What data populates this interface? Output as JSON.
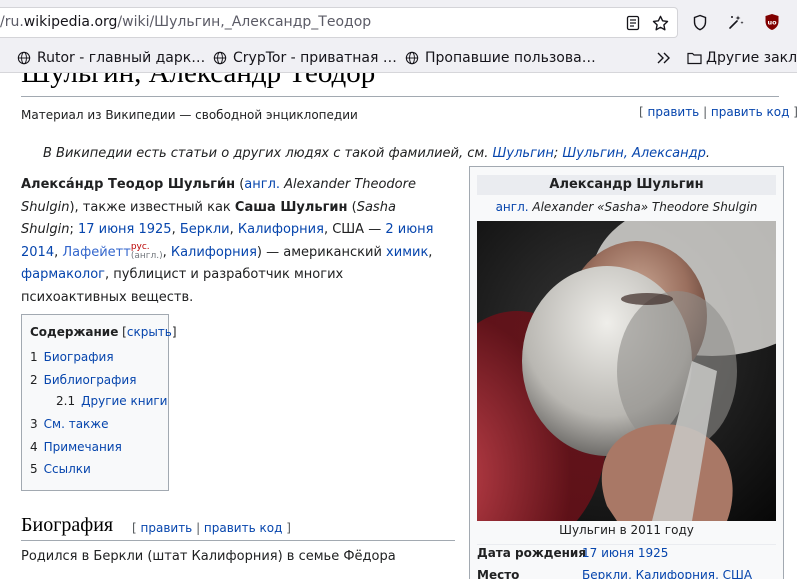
{
  "browser": {
    "url_prefix": "/ru.",
    "url_domain": "wikipedia.org",
    "url_path": "/wiki/Шульгин,_Александр_Теодор",
    "bookmarks": [
      "Rutor - главный дарк…",
      "CrypTor - приватная …",
      "Пропавшие пользова…"
    ],
    "other_bookmarks": "Другие заклад"
  },
  "article": {
    "title": "Шульгин, Александр Теодор",
    "tagline": "Материал из Википедии — свободной энциклопедии",
    "edit": "править",
    "edit_code": "править код",
    "hatnote_prefix": "В Википедии есть статьи о других людях с такой фамилией, см.",
    "hatnote_link1": "Шульгин",
    "hatnote_sep": ";",
    "hatnote_link2": "Шульгин, Александр",
    "hatnote_end": ".",
    "lead": {
      "name_bold": "Алекса́ндр Теодор Шульги́н",
      "open_paren": " (",
      "lang_link": "англ.",
      "orig_name": " Alexander Theodore Shulgin",
      "also": "), также известный как ",
      "nick_bold": "Саша Шульгин",
      "nick_orig_open": " (",
      "nick_orig": "Sasha Shulgin",
      "semi": "; ",
      "birth_date": "17 июня 1925",
      "comma1": ", ",
      "berkeley": "Беркли",
      "comma2": ", ",
      "california1": "Калифорния",
      "usa": ", США — ",
      "death_date": "2 июня 2014",
      "comma3": ", ",
      "lafayette": "Лафейетт",
      "rus": "рус.",
      "eng": "(англ.)",
      "comma4": ", ",
      "california2": "Калифорния",
      "dash": ") — американский ",
      "chemist": "химик",
      "comma5": ",",
      "pharmacologist": "фармаколог",
      "rest": ", публицист и разработчик многих психоактивных веществ."
    },
    "toc": {
      "heading": "Содержание",
      "hide_open": " [",
      "hide": "скрыть",
      "hide_close": "]",
      "items": [
        {
          "num": "1",
          "label": "Биография"
        },
        {
          "num": "2",
          "label": "Библиография"
        },
        {
          "num": "2.1",
          "label": "Другие книги"
        },
        {
          "num": "3",
          "label": "См. также"
        },
        {
          "num": "4",
          "label": "Примечания"
        },
        {
          "num": "5",
          "label": "Ссылки"
        }
      ]
    },
    "section": {
      "title": "Биография",
      "text": "Родился в Беркли (штат Калифорния) в семье Фёдора"
    }
  },
  "infobox": {
    "title": "Александр Шульгин",
    "orig_lang": "англ.",
    "orig_name": " Alexander «Sasha» Theodore Shulgin",
    "caption": "Шульгин в 2011 году",
    "birth_key": "Дата рождения",
    "birth_value": "17 июня 1925",
    "place_key": "Место",
    "place_value": "Беркли, Калифорния, США"
  },
  "colors": {
    "link": "#0645ad",
    "text": "#202122",
    "chrome_bg": "#f0f0f4",
    "infobox_bg": "#f8f9fa",
    "border": "#a2a9b1"
  }
}
